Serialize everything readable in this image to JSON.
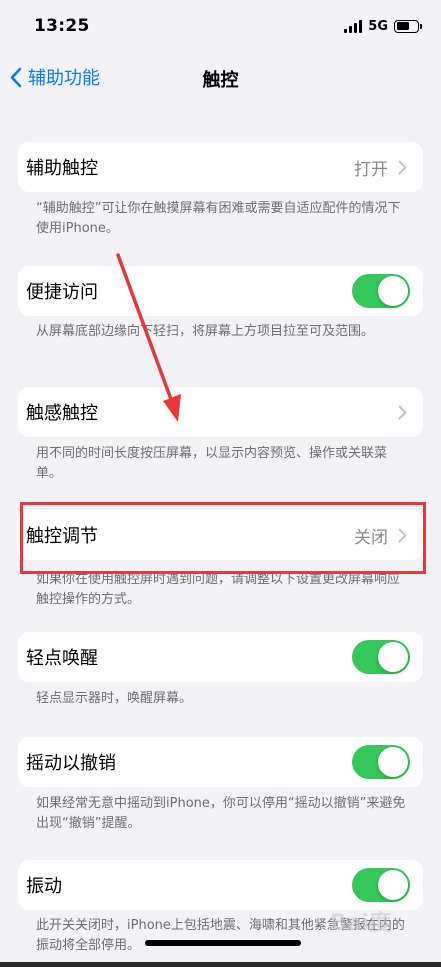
{
  "status_bar": {
    "time": "13:25",
    "network": "5G",
    "battery_level": 0.6
  },
  "nav": {
    "back_label": "辅助功能",
    "title": "触控"
  },
  "rows": [
    {
      "label": "辅助触控",
      "value": "打开",
      "control": "chevron",
      "footnote": "“辅助触控”可让你在触摸屏幕有困难或需要自适应配件的情况下使用iPhone。"
    },
    {
      "label": "便捷访问",
      "control": "toggle",
      "on": true,
      "footnote": "从屏幕底部边缘向下轻扫，将屏幕上方项目拉至可及范围。"
    },
    {
      "label": "触感触控",
      "control": "chevron",
      "footnote": "用不同的时间长度按压屏幕，以显示内容预览、操作或关联菜单。"
    },
    {
      "label": "触控调节",
      "value": "关闭",
      "control": "chevron",
      "footnote": "如果你在使用触控屏时遇到问题，请调整以下设置更改屏幕响应触控操作的方式。"
    },
    {
      "label": "轻点唤醒",
      "control": "toggle",
      "on": true,
      "footnote": "轻点显示器时，唤醒屏幕。"
    },
    {
      "label": "摇动以撤销",
      "control": "toggle",
      "on": true,
      "footnote": "如果经常无意中摇动到iPhone，你可以停用“摇动以撤销”来避免出现“撤销”提醒。"
    },
    {
      "label": "振动",
      "control": "toggle",
      "on": true,
      "footnote": "此开关关闭时，iPhone上包括地震、海啸和其他紧急警报在内的振动将全部停用。"
    }
  ],
  "watermark": "Bai度",
  "colors": {
    "accent": "#0a7aff",
    "toggle_on": "#34c759",
    "annotation": "#e8383d",
    "background": "#f2f2f7"
  }
}
